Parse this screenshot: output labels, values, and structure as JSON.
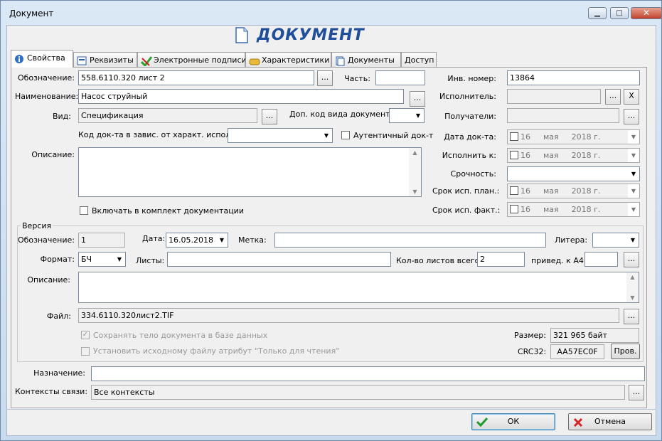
{
  "window": {
    "title": "Документ",
    "minimize": "▁",
    "maximize": "□",
    "close": "✕"
  },
  "header": {
    "title": "ДОКУМЕНТ"
  },
  "tabs": [
    {
      "label": "Свойства",
      "icon": "info-icon"
    },
    {
      "label": "Реквизиты",
      "icon": "form-icon"
    },
    {
      "label": "Электронные подписи",
      "icon": "checkmark-icon"
    },
    {
      "label": "Характеристики",
      "icon": "tags-icon"
    },
    {
      "label": "Документы",
      "icon": "documents-icon"
    },
    {
      "label": "Доступ",
      "icon": ""
    }
  ],
  "props": {
    "designation_label": "Обозначение:",
    "designation": "558.6110.320 лист 2",
    "part_label": "Часть:",
    "part": "",
    "name_label": "Наименование:",
    "name": "Насос струйный",
    "kind_label": "Вид:",
    "kind": "Спецификация",
    "extra_code_label": "Доп. код вида документа:",
    "extra_code": "",
    "code_usage_label": "Код док-та в завис. от характ. использ:",
    "code_usage": "",
    "authentic_label": "Аутентичный док-т",
    "description_label": "Описание:",
    "description": "",
    "include_label": "Включать в комплект документации",
    "dots": "...",
    "clear": "X"
  },
  "right": {
    "inv_label": "Инв. номер:",
    "inv": "13864",
    "executor_label": "Исполнитель:",
    "recipients_label": "Получатели:",
    "date_doc_label": "Дата док-та:",
    "due_label": "Исполнить к:",
    "urgency_label": "Срочность:",
    "plan_label": "Срок исп. план.:",
    "fact_label": "Срок исп. факт.:",
    "day": "16",
    "month": "мая",
    "year": "2018 г."
  },
  "version": {
    "legend": "Версия",
    "designation_label": "Обозначение:",
    "designation": "1",
    "date_label": "Дата:",
    "date": "16.05.2018",
    "mark_label": "Метка:",
    "mark": "",
    "letter_label": "Литера:",
    "format_label": "Формат:",
    "format": "БЧ",
    "sheets_label": "Листы:",
    "sheets": "",
    "total_label": "Кол-во листов всего:",
    "total": "2",
    "a4_label": "привед. к А4:",
    "a4": "",
    "description_label": "Описание:",
    "file_label": "Файл:",
    "file": "334.6110.320лист2.TIF",
    "save_body_label": "Сохранять тело документа в базе данных",
    "readonly_label": "Установить исходному файлу атрибут \"Только для чтения\"",
    "size_label": "Размер:",
    "size": "321 965 байт",
    "crc_label": "CRC32:",
    "crc": "AA57EC0F",
    "check_button": "Пров."
  },
  "bottom": {
    "purpose_label": "Назначение:",
    "purpose": "",
    "contexts_label": "Контексты связи:",
    "contexts": "Все контексты"
  },
  "buttons": {
    "ok": "ОК",
    "cancel": "Отмена"
  }
}
